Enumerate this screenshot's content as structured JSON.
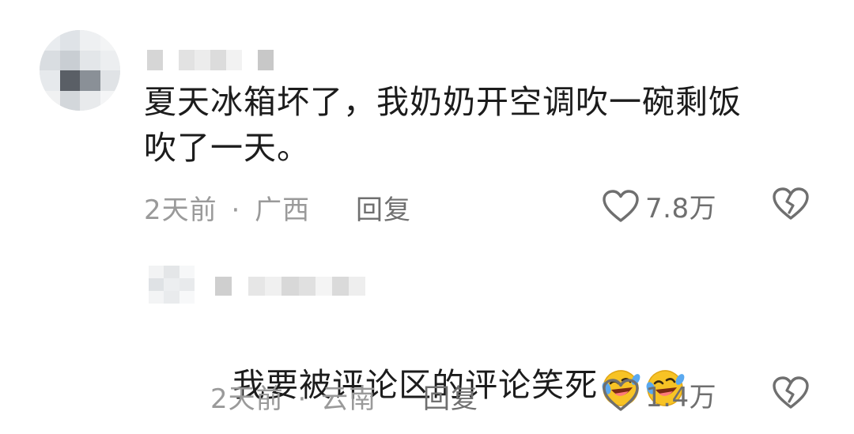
{
  "comment": {
    "text": "夏天冰箱坏了，我奶奶开空调吹一碗剩饭\n吹了一天。",
    "time": "2天前",
    "separator": "·",
    "location": "广西",
    "reply_label": "回复",
    "like_count": "7.8万",
    "icons": [
      "heart-outline-icon",
      "broken-heart-icon"
    ]
  },
  "reply": {
    "text": "我要被评论区的评论笑死",
    "emojis": [
      "laughing-crying-emoji",
      "laughing-crying-emoji"
    ],
    "time": "2天前",
    "separator": "·",
    "location": "云南",
    "reply_label": "回复",
    "like_count": "1.4万",
    "icons": [
      "heart-outline-icon",
      "broken-heart-icon"
    ]
  },
  "colors": {
    "text": "#1c1c1c",
    "meta": "#9a9a9a",
    "action": "#6f6f6f",
    "emoji_yellow": "#f7c325",
    "emoji_tear": "#5aa9f0"
  }
}
